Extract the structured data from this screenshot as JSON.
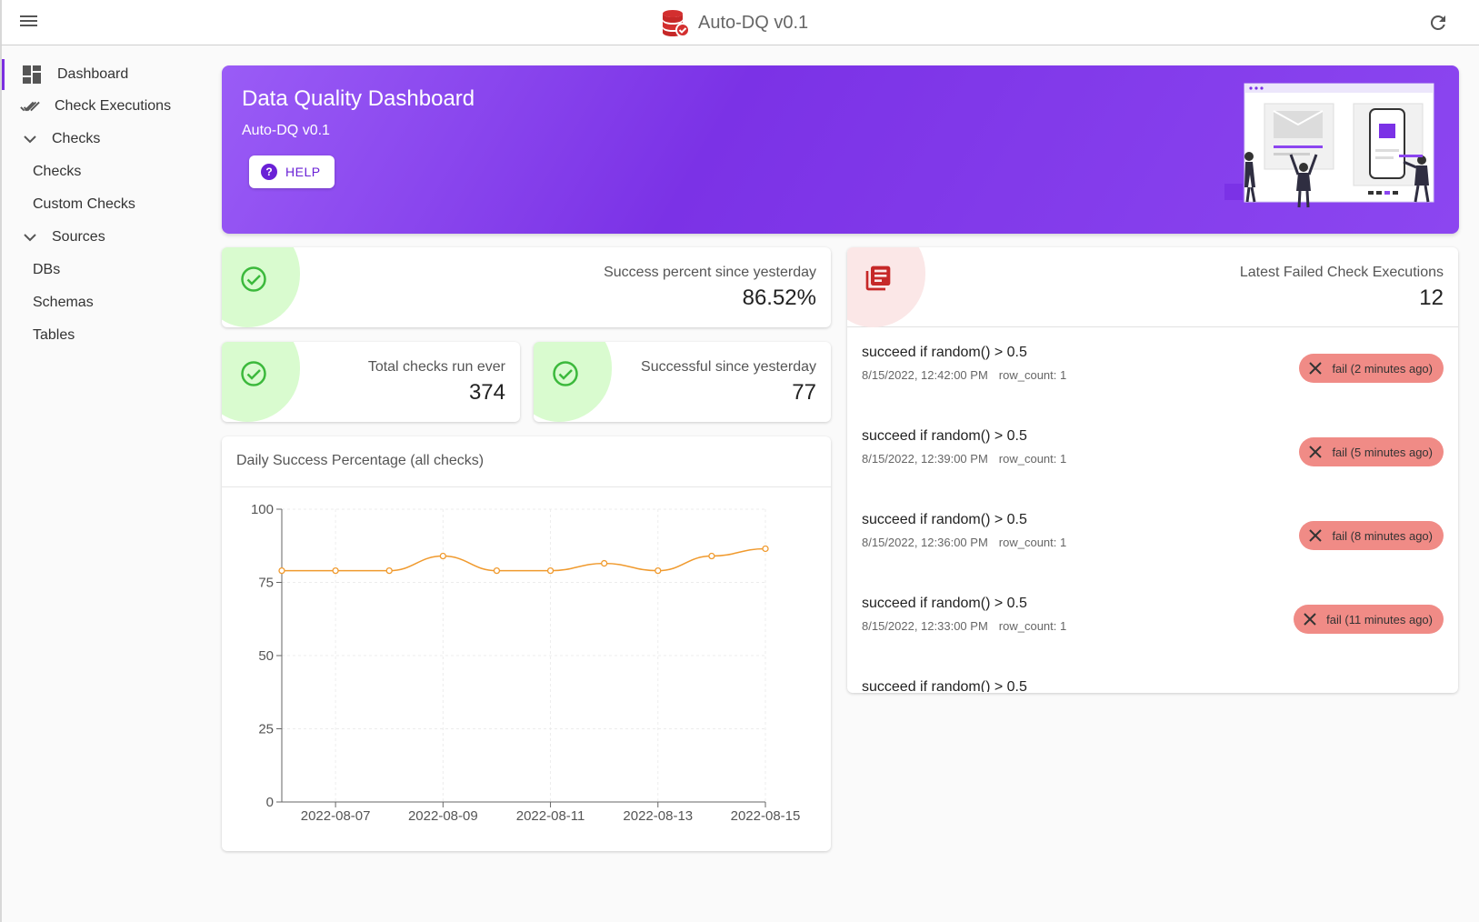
{
  "app": {
    "title": "Auto-DQ v0.1"
  },
  "sidebar": {
    "items": [
      {
        "label": "Dashboard"
      },
      {
        "label": "Check Executions"
      },
      {
        "label": "Checks"
      },
      {
        "label": "Checks"
      },
      {
        "label": "Custom Checks"
      },
      {
        "label": "Sources"
      },
      {
        "label": "DBs"
      },
      {
        "label": "Schemas"
      },
      {
        "label": "Tables"
      }
    ]
  },
  "hero": {
    "title": "Data Quality Dashboard",
    "subtitle": "Auto-DQ v0.1",
    "help_label": "HELP"
  },
  "stats": {
    "success_percent": {
      "label": "Success percent since yesterday",
      "value": "86.52%"
    },
    "total_checks": {
      "label": "Total checks run ever",
      "value": "374"
    },
    "successful_since": {
      "label": "Successful since yesterday",
      "value": "77"
    },
    "latest_failed": {
      "label": "Latest Failed Check Executions",
      "value": "12"
    }
  },
  "chart": {
    "title": "Daily Success Percentage (all checks)"
  },
  "chart_data": {
    "type": "line",
    "title": "Daily Success Percentage (all checks)",
    "x": [
      "2022-08-06",
      "2022-08-07",
      "2022-08-08",
      "2022-08-09",
      "2022-08-10",
      "2022-08-11",
      "2022-08-12",
      "2022-08-13",
      "2022-08-14",
      "2022-08-15"
    ],
    "series": [
      {
        "values": [
          79,
          79,
          79,
          84,
          79,
          79,
          81.5,
          79,
          84,
          86.5
        ]
      }
    ],
    "x_tick_labels": [
      "2022-08-07",
      "2022-08-09",
      "2022-08-11",
      "2022-08-13",
      "2022-08-15"
    ],
    "y_ticks": [
      0,
      25,
      50,
      75,
      100
    ],
    "ylim": [
      0,
      100
    ],
    "grid": true,
    "color": "#f09a2e"
  },
  "failed_executions": [
    {
      "title": "succeed if random() > 0.5",
      "time": "8/15/2022, 12:42:00 PM",
      "row_count": "row_count: 1",
      "status": "fail (2 minutes ago)"
    },
    {
      "title": "succeed if random() > 0.5",
      "time": "8/15/2022, 12:39:00 PM",
      "row_count": "row_count: 1",
      "status": "fail (5 minutes ago)"
    },
    {
      "title": "succeed if random() > 0.5",
      "time": "8/15/2022, 12:36:00 PM",
      "row_count": "row_count: 1",
      "status": "fail (8 minutes ago)"
    },
    {
      "title": "succeed if random() > 0.5",
      "time": "8/15/2022, 12:33:00 PM",
      "row_count": "row_count: 1",
      "status": "fail (11 minutes ago)"
    },
    {
      "title": "succeed if random() > 0.5"
    }
  ],
  "colors": {
    "accent": "#7b2fe0",
    "success_blob": "#d9fbcf",
    "success_icon": "#3cb93c",
    "fail_icon": "#c62828",
    "fail_chip": "#f08b86"
  }
}
